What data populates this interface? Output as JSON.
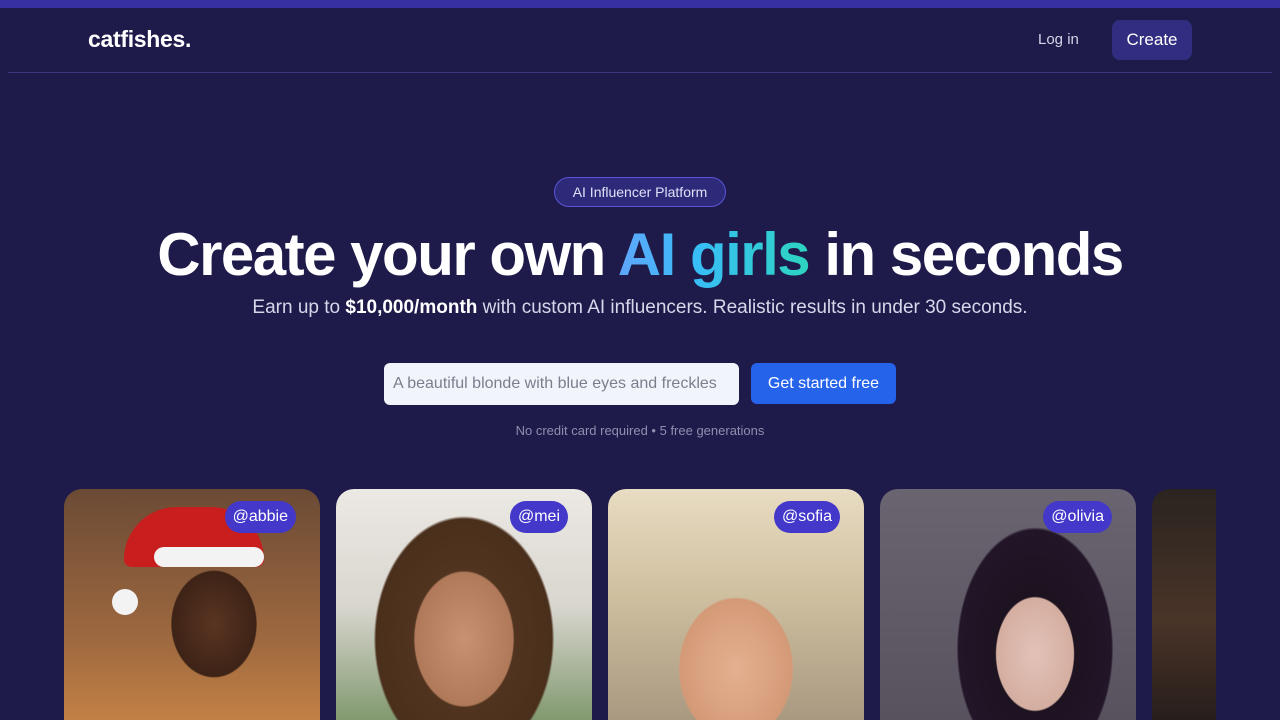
{
  "header": {
    "logo": "catfishes.",
    "login_label": "Log in",
    "create_label": "Create"
  },
  "hero": {
    "badge": "AI Influencer Platform",
    "headline_before": "Create your own ",
    "headline_highlight": "AI girls",
    "headline_after": " in seconds",
    "subline_before": "Earn up to ",
    "subline_bold": "$10,000/month",
    "subline_after": " with custom AI influencers. Realistic results in under 30 seconds."
  },
  "prompt": {
    "placeholder": "A beautiful blonde with blue eyes and freckles",
    "value": "",
    "button_label": "Get started free",
    "note": "No credit card required • 5 free generations"
  },
  "gallery": {
    "cards": [
      {
        "handle": "@abbie"
      },
      {
        "handle": "@mei"
      },
      {
        "handle": "@sofia"
      },
      {
        "handle": "@olivia"
      },
      {
        "handle": ""
      }
    ]
  },
  "colors": {
    "background": "#1e1b4b",
    "accent_button": "#2563eb",
    "nav_button": "#312e81",
    "handle_badge": "#4338ca",
    "gradient_start": "#60a5fa",
    "gradient_end": "#2dd4bf"
  }
}
